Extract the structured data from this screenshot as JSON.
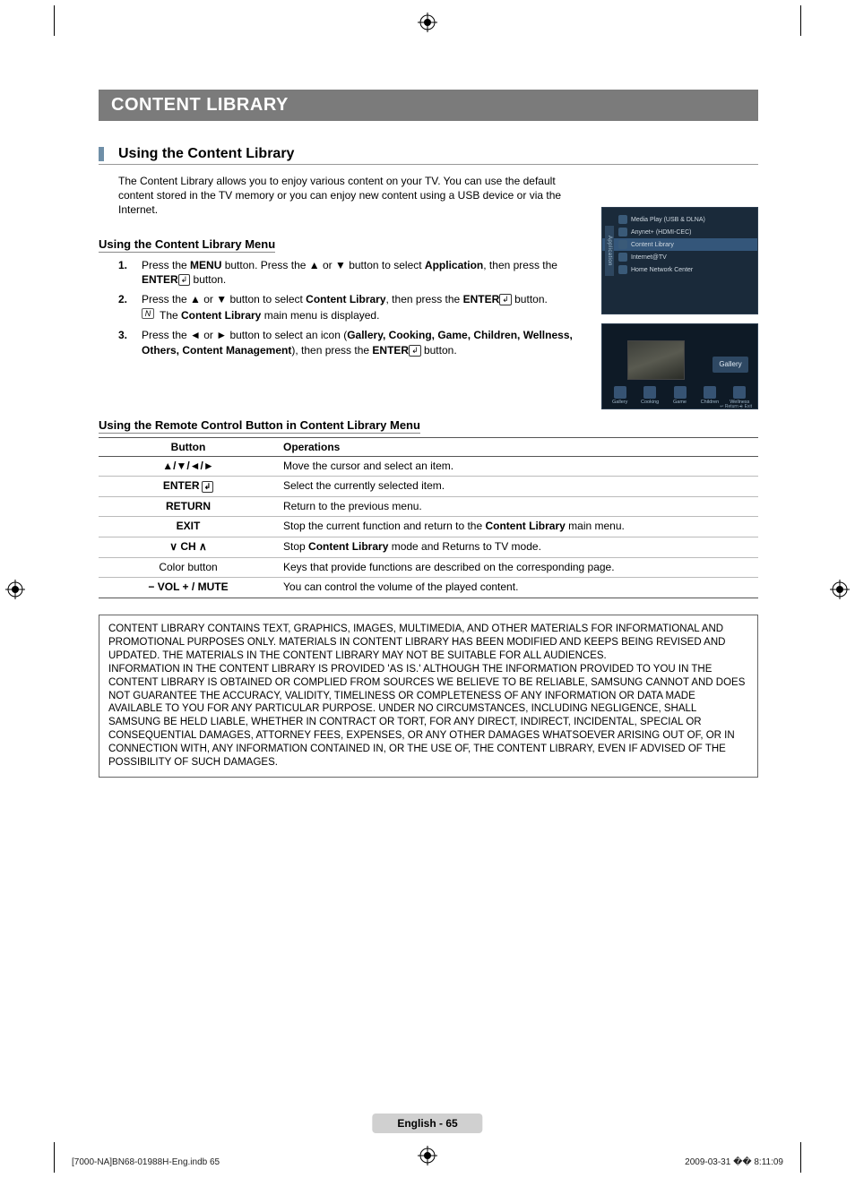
{
  "chapter": "CONTENT LIBRARY",
  "section_title": "Using the Content Library",
  "intro": "The Content Library allows you to enjoy various content on your TV. You can use the default content stored in the TV memory or you can enjoy new content using a USB device or via the Internet.",
  "sub1": "Using the Content Library Menu",
  "steps": [
    {
      "num": "1.",
      "pre": "Press the ",
      "b1": "MENU",
      "mid1": " button. Press the ▲ or ▼ button to select ",
      "b2": "Application",
      "mid2": ", then press the ",
      "b3": "ENTER",
      "post": " button."
    },
    {
      "num": "2.",
      "pre": "Press the ▲ or ▼ button to select ",
      "b1": "Content Library",
      "mid1": ", then press the ",
      "b2": "ENTER",
      "post": " button.",
      "note_pre": "The ",
      "note_b": "Content Library",
      "note_post": " main menu is displayed."
    },
    {
      "num": "3.",
      "pre": "Press the ◄ or ► button to select an icon (",
      "b1": "Gallery, Cooking, Game, Children, Wellness, Others, Content Management",
      "mid1": "), then press the ",
      "b2": "ENTER",
      "post": " button."
    }
  ],
  "sub2": "Using the Remote Control Button in Content Library Menu",
  "table": {
    "head": [
      "Button",
      "Operations"
    ],
    "rows": [
      {
        "btn": "▲/▼/◄/►",
        "op_pre": "",
        "op_plain": "Move the cursor and select an item."
      },
      {
        "btn": "ENTER",
        "enter_icon": true,
        "op_plain": "Select the currently selected item."
      },
      {
        "btn": "RETURN",
        "op_plain": "Return to the previous menu."
      },
      {
        "btn": "EXIT",
        "op_pre": "Stop the current function and return to the ",
        "op_b": "Content Library",
        "op_post": " main menu."
      },
      {
        "btn_html": "ch",
        "op_pre": "Stop ",
        "op_b": "Content Library",
        "op_post": " mode and Returns to TV mode."
      },
      {
        "btn_plain": "Color button",
        "op_plain": "Keys that provide functions are described on the corresponding page."
      },
      {
        "btn_html": "vol",
        "op_plain": "You can control the volume of the played content."
      }
    ],
    "ch_label": "CH",
    "vol_label": "VOL",
    "mute_label": "MUTE"
  },
  "disclaimer": [
    "CONTENT LIBRARY CONTAINS TEXT, GRAPHICS, IMAGES, MULTIMEDIA, AND OTHER MATERIALS FOR INFORMATIONAL AND PROMOTIONAL PURPOSES ONLY. MATERIALS IN CONTENT LIBRARY HAS BEEN MODIFIED AND KEEPS BEING REVISED AND UPDATED. THE MATERIALS IN THE CONTENT LIBRARY MAY NOT BE SUITABLE FOR ALL AUDIENCES.",
    "INFORMATION IN THE CONTENT LIBRARY IS PROVIDED 'AS IS.' ALTHOUGH THE INFORMATION PROVIDED TO YOU IN THE CONTENT LIBRARY IS OBTAINED OR COMPLIED FROM SOURCES WE BELIEVE TO BE RELIABLE, SAMSUNG CANNOT AND DOES NOT GUARANTEE THE ACCURACY, VALIDITY, TIMELINESS OR COMPLETENESS OF ANY INFORMATION OR DATA MADE AVAILABLE TO YOU FOR ANY PARTICULAR PURPOSE. UNDER NO CIRCUMSTANCES, INCLUDING NEGLIGENCE, SHALL SAMSUNG BE HELD LIABLE, WHETHER IN CONTRACT OR TORT, FOR ANY DIRECT, INDIRECT, INCIDENTAL, SPECIAL OR CONSEQUENTIAL DAMAGES, ATTORNEY FEES, EXPENSES, OR ANY OTHER DAMAGES WHATSOEVER ARISING OUT OF, OR IN CONNECTION WITH, ANY INFORMATION CONTAINED IN, OR THE USE OF, THE CONTENT LIBRARY, EVEN IF ADVISED OF THE POSSIBILITY OF SUCH DAMAGES."
  ],
  "screenshot1": {
    "side": "Application",
    "items": [
      "Media Play (USB & DLNA)",
      "Anynet+ (HDMI-CEC)",
      "Content Library",
      "Internet@TV",
      "Home Network Center"
    ],
    "selected_index": 2
  },
  "screenshot2": {
    "badge": "Gallery",
    "icons": [
      "Gallery",
      "Cooking",
      "Game",
      "Children",
      "Wellness"
    ],
    "ret": "↩ Return   ⎆ Exit"
  },
  "footer_lang": "English - 65",
  "footer_left": "[7000-NA]BN68-01988H-Eng.indb   65",
  "footer_right": "2009-03-31   �� 8:11:09"
}
